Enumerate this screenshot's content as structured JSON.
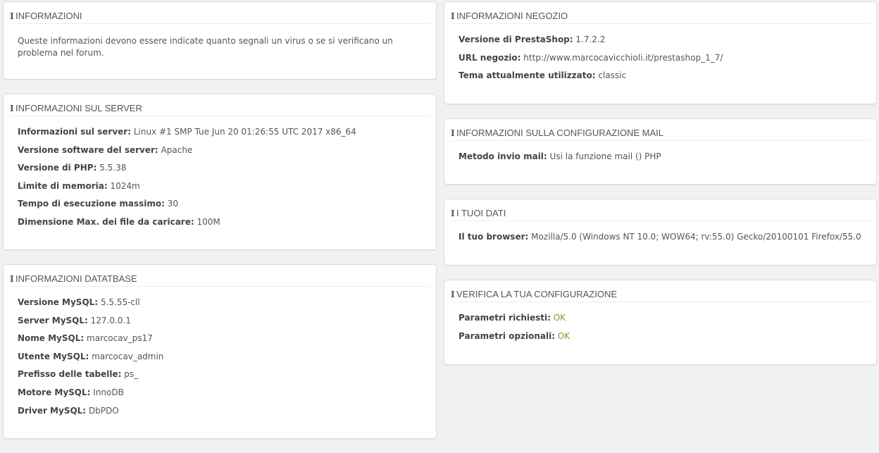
{
  "left_column": {
    "info_panel": {
      "title": "INFORMAZIONI",
      "text": "Queste informazioni devono essere indicate quanto segnali un virus o se si verificano un problema nel forum."
    },
    "server_panel": {
      "title": "INFORMAZIONI SUL SERVER",
      "rows": [
        {
          "label": "Informazioni sul server:",
          "value": "Linux #1 SMP Tue Jun 20 01:26:55 UTC 2017 x86_64"
        },
        {
          "label": "Versione software del server:",
          "value": "Apache"
        },
        {
          "label": "Versione di PHP:",
          "value": "5.5.38"
        },
        {
          "label": "Limite di memoria:",
          "value": "1024m"
        },
        {
          "label": "Tempo di esecuzione massimo:",
          "value": "30"
        },
        {
          "label": "Dimensione Max. dei file da caricare:",
          "value": "100M"
        }
      ]
    },
    "database_panel": {
      "title": "INFORMAZIONI DATATBASE",
      "rows": [
        {
          "label": "Versione MySQL:",
          "value": "5.5.55-cll"
        },
        {
          "label": "Server MySQL:",
          "value": "127.0.0.1"
        },
        {
          "label": "Nome MySQL:",
          "value": "marcocav_ps17"
        },
        {
          "label": "Utente MySQL:",
          "value": "marcocav_admin"
        },
        {
          "label": "Prefisso delle tabelle:",
          "value": "ps_"
        },
        {
          "label": "Motore MySQL:",
          "value": "InnoDB"
        },
        {
          "label": "Driver MySQL:",
          "value": "DbPDO"
        }
      ]
    }
  },
  "right_column": {
    "shop_panel": {
      "title": "INFORMAZIONI NEGOZIO",
      "rows": [
        {
          "label": "Versione di PrestaShop:",
          "value": "1.7.2.2"
        },
        {
          "label": "URL negozio:",
          "value": "http://www.marcocavicchioli.it/prestashop_1_7/"
        },
        {
          "label": "Tema attualmente utilizzato:",
          "value": "classic"
        }
      ]
    },
    "mail_panel": {
      "title": "INFORMAZIONI SULLA CONFIGURAZIONE MAIL",
      "rows": [
        {
          "label": "Metodo invio mail:",
          "value": "Usi la funzione mail () PHP"
        }
      ]
    },
    "user_panel": {
      "title": "I TUOI DATI",
      "rows": [
        {
          "label": "Il tuo browser:",
          "value": "Mozilla/5.0 (Windows NT 10.0; WOW64; rv:55.0) Gecko/20100101 Firefox/55.0"
        }
      ]
    },
    "config_panel": {
      "title": "VERIFICA LA TUA CONFIGURAZIONE",
      "rows": [
        {
          "label": "Parametri richiesti:",
          "value": "OK"
        },
        {
          "label": "Parametri opzionali:",
          "value": "OK"
        }
      ]
    }
  },
  "icons": {
    "panel_heading_icon": "info-icon"
  },
  "colors": {
    "background": "#eff1f2",
    "panel_border": "#dcdcdc",
    "ok_status": "#72a12e",
    "text": "#555555"
  }
}
